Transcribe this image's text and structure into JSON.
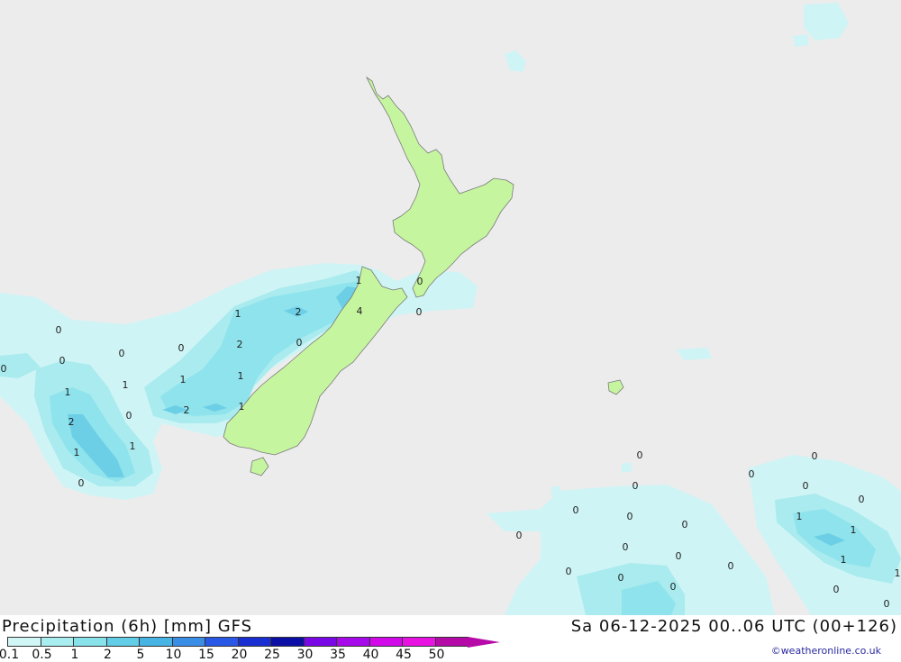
{
  "title": "Precipitation (6h) [mm] GFS",
  "datetime": "Sa 06-12-2025 00..06 UTC (00+126)",
  "credit": "©weatheronline.co.uk",
  "colors": {
    "land": "#c6f5a0",
    "sea": "#ececec",
    "precip_01": "#cff4f5",
    "precip_05": "#a9ebee",
    "precip_1": "#8ee3ec",
    "precip_2": "#6ccfe6"
  },
  "legend": {
    "ticks": [
      "0.1",
      "0.5",
      "1",
      "2",
      "5",
      "10",
      "15",
      "20",
      "25",
      "30",
      "35",
      "40",
      "45",
      "50"
    ],
    "colors": [
      "#d0f6f6",
      "#a8eef0",
      "#88e2ea",
      "#62cde6",
      "#48b4e4",
      "#3a8ee6",
      "#2a58e6",
      "#1a2fd2",
      "#0c0fa6",
      "#7a08e6",
      "#a70aea",
      "#d20aea",
      "#e812e2",
      "#b60aa8"
    ]
  },
  "map_labels": [
    {
      "t": "1"
    },
    {
      "t": "0"
    },
    {
      "t": "0"
    },
    {
      "t": "2"
    },
    {
      "t": "4"
    },
    {
      "t": "1"
    },
    {
      "t": "2"
    },
    {
      "t": "0"
    },
    {
      "t": "0"
    },
    {
      "t": "0"
    },
    {
      "t": "0"
    },
    {
      "t": "0"
    },
    {
      "t": "1"
    },
    {
      "t": "1"
    },
    {
      "t": "1"
    },
    {
      "t": "0"
    },
    {
      "t": "2"
    },
    {
      "t": "1"
    },
    {
      "t": "2"
    },
    {
      "t": "1"
    },
    {
      "t": "1"
    },
    {
      "t": "1"
    },
    {
      "t": "0"
    },
    {
      "t": "0"
    },
    {
      "t": "0"
    },
    {
      "t": "0"
    },
    {
      "t": "0"
    },
    {
      "t": "0"
    },
    {
      "t": "0"
    },
    {
      "t": "0"
    },
    {
      "t": "0"
    },
    {
      "t": "0"
    },
    {
      "t": "0"
    },
    {
      "t": "0"
    },
    {
      "t": "0"
    },
    {
      "t": "0"
    },
    {
      "t": "0"
    },
    {
      "t": "1"
    },
    {
      "t": "0"
    },
    {
      "t": "0"
    },
    {
      "t": "0"
    },
    {
      "t": "1"
    },
    {
      "t": "1"
    },
    {
      "t": "1"
    },
    {
      "t": "0"
    },
    {
      "t": "0"
    }
  ]
}
